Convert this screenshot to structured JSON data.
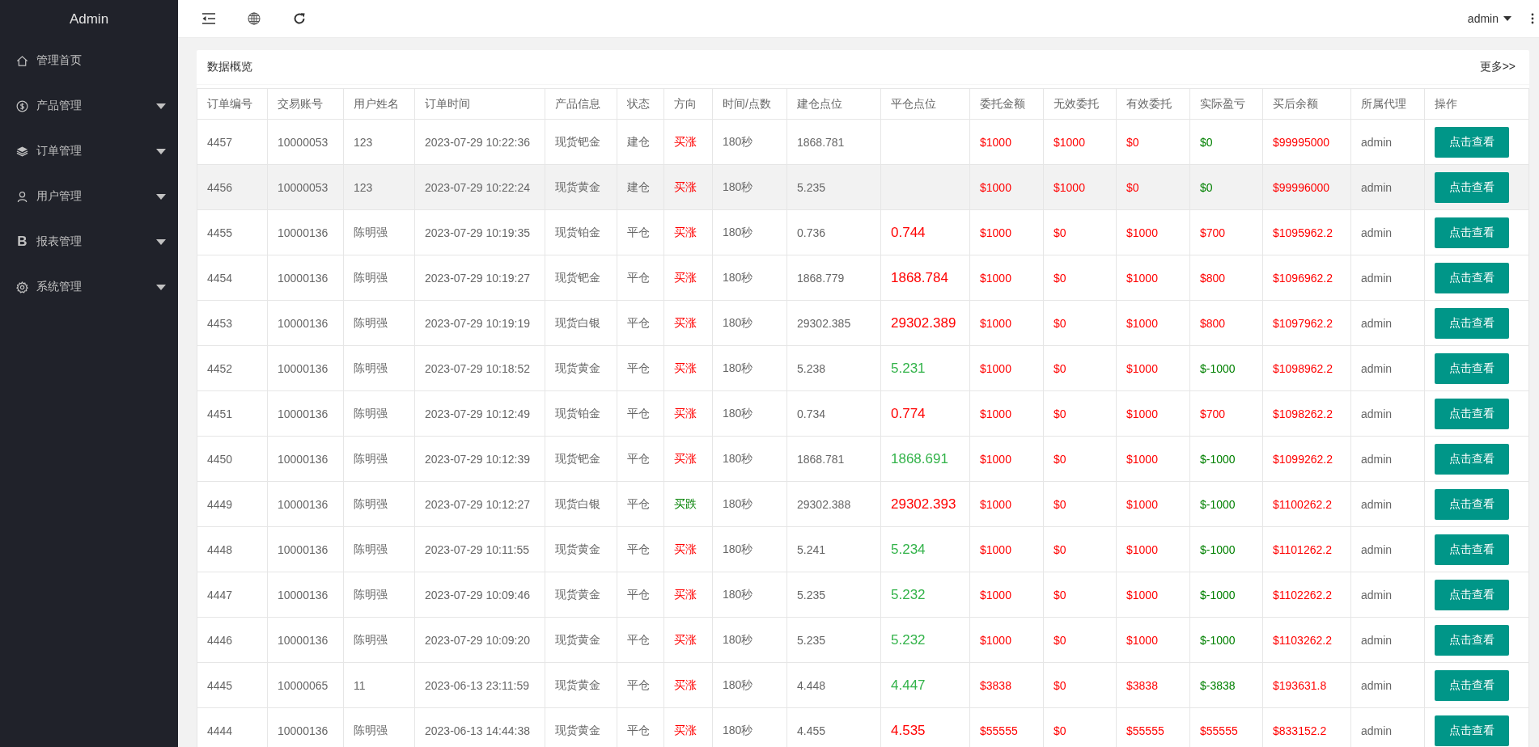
{
  "sidebar": {
    "brand": "Admin",
    "items": [
      {
        "label": "管理首页",
        "kind": "link"
      },
      {
        "label": "产品管理",
        "kind": "menu",
        "expanded": false
      },
      {
        "label": "订单管理",
        "kind": "menu",
        "expanded": false
      },
      {
        "label": "用户管理",
        "kind": "menu",
        "expanded": false
      },
      {
        "label": "报表管理",
        "kind": "menu",
        "expanded": false,
        "glyph": "B"
      },
      {
        "label": "系统管理",
        "kind": "menu",
        "expanded": false
      }
    ]
  },
  "topbar": {
    "user": "admin"
  },
  "card": {
    "title": "数据概览",
    "more": "更多>>"
  },
  "table": {
    "columns": [
      "订单编号",
      "交易账号",
      "用户姓名",
      "订单时间",
      "产品信息",
      "状态",
      "方向",
      "时间/点数",
      "建仓点位",
      "平仓点位",
      "委托金额",
      "无效委托",
      "有效委托",
      "实际盈亏",
      "买后余额",
      "所属代理",
      "操作"
    ],
    "rows": [
      {
        "order_no": "4457",
        "account": "10000053",
        "user_name": "123",
        "order_time": "2023-07-29 10:22:36",
        "product": "现货钯金",
        "status": "建仓",
        "direction": {
          "text": "买涨",
          "color": "#ff0000"
        },
        "duration": "180秒",
        "open_price": "1868.781",
        "amount": "$1000",
        "invalid": "$1000",
        "valid": "$0",
        "pnl": {
          "text": "$0",
          "color": "#008000"
        },
        "balance": "$99995000",
        "agent": "admin",
        "action": "点击查看",
        "highlighted": false
      },
      {
        "order_no": "4456",
        "account": "10000053",
        "user_name": "123",
        "order_time": "2023-07-29 10:22:24",
        "product": "现货黄金",
        "status": "建仓",
        "direction": {
          "text": "买涨",
          "color": "#ff0000"
        },
        "duration": "180秒",
        "open_price": "5.235",
        "amount": "$1000",
        "invalid": "$1000",
        "valid": "$0",
        "pnl": {
          "text": "$0",
          "color": "#008000"
        },
        "balance": "$99996000",
        "agent": "admin",
        "action": "点击查看",
        "highlighted": true
      },
      {
        "order_no": "4455",
        "account": "10000136",
        "user_name": "陈明强",
        "order_time": "2023-07-29 10:19:35",
        "product": "现货铂金",
        "status": "平仓",
        "direction": {
          "text": "买涨",
          "color": "#ff0000"
        },
        "duration": "180秒",
        "open_price": "0.736",
        "close_price": {
          "text": "0.744",
          "color": "#ff0000"
        },
        "amount": "$1000",
        "invalid": "$0",
        "valid": "$1000",
        "pnl": {
          "text": "$700",
          "color": "#ff0000"
        },
        "balance": "$1095962.2",
        "agent": "admin",
        "action": "点击查看",
        "highlighted": false
      },
      {
        "order_no": "4454",
        "account": "10000136",
        "user_name": "陈明强",
        "order_time": "2023-07-29 10:19:27",
        "product": "现货钯金",
        "status": "平仓",
        "direction": {
          "text": "买涨",
          "color": "#ff0000"
        },
        "duration": "180秒",
        "open_price": "1868.779",
        "close_price": {
          "text": "1868.784",
          "color": "#ff0000"
        },
        "amount": "$1000",
        "invalid": "$0",
        "valid": "$1000",
        "pnl": {
          "text": "$800",
          "color": "#ff0000"
        },
        "balance": "$1096962.2",
        "agent": "admin",
        "action": "点击查看",
        "highlighted": false
      },
      {
        "order_no": "4453",
        "account": "10000136",
        "user_name": "陈明强",
        "order_time": "2023-07-29 10:19:19",
        "product": "现货白银",
        "status": "平仓",
        "direction": {
          "text": "买涨",
          "color": "#ff0000"
        },
        "duration": "180秒",
        "open_price": "29302.385",
        "close_price": {
          "text": "29302.389",
          "color": "#ff0000"
        },
        "amount": "$1000",
        "invalid": "$0",
        "valid": "$1000",
        "pnl": {
          "text": "$800",
          "color": "#ff0000"
        },
        "balance": "$1097962.2",
        "agent": "admin",
        "action": "点击查看",
        "highlighted": false
      },
      {
        "order_no": "4452",
        "account": "10000136",
        "user_name": "陈明强",
        "order_time": "2023-07-29 10:18:52",
        "product": "现货黄金",
        "status": "平仓",
        "direction": {
          "text": "买涨",
          "color": "#ff0000"
        },
        "duration": "180秒",
        "open_price": "5.238",
        "close_price": {
          "text": "5.231",
          "color": "#33b34a"
        },
        "amount": "$1000",
        "invalid": "$0",
        "valid": "$1000",
        "pnl": {
          "text": "$-1000",
          "color": "#008000"
        },
        "balance": "$1098962.2",
        "agent": "admin",
        "action": "点击查看",
        "highlighted": false
      },
      {
        "order_no": "4451",
        "account": "10000136",
        "user_name": "陈明强",
        "order_time": "2023-07-29 10:12:49",
        "product": "现货铂金",
        "status": "平仓",
        "direction": {
          "text": "买涨",
          "color": "#ff0000"
        },
        "duration": "180秒",
        "open_price": "0.734",
        "close_price": {
          "text": "0.774",
          "color": "#ff0000"
        },
        "amount": "$1000",
        "invalid": "$0",
        "valid": "$1000",
        "pnl": {
          "text": "$700",
          "color": "#ff0000"
        },
        "balance": "$1098262.2",
        "agent": "admin",
        "action": "点击查看",
        "highlighted": false
      },
      {
        "order_no": "4450",
        "account": "10000136",
        "user_name": "陈明强",
        "order_time": "2023-07-29 10:12:39",
        "product": "现货钯金",
        "status": "平仓",
        "direction": {
          "text": "买涨",
          "color": "#ff0000"
        },
        "duration": "180秒",
        "open_price": "1868.781",
        "close_price": {
          "text": "1868.691",
          "color": "#33b34a"
        },
        "amount": "$1000",
        "invalid": "$0",
        "valid": "$1000",
        "pnl": {
          "text": "$-1000",
          "color": "#008000"
        },
        "balance": "$1099262.2",
        "agent": "admin",
        "action": "点击查看",
        "highlighted": false
      },
      {
        "order_no": "4449",
        "account": "10000136",
        "user_name": "陈明强",
        "order_time": "2023-07-29 10:12:27",
        "product": "现货白银",
        "status": "平仓",
        "direction": {
          "text": "买跌",
          "color": "#008000"
        },
        "duration": "180秒",
        "open_price": "29302.388",
        "close_price": {
          "text": "29302.393",
          "color": "#ff0000"
        },
        "amount": "$1000",
        "invalid": "$0",
        "valid": "$1000",
        "pnl": {
          "text": "$-1000",
          "color": "#008000"
        },
        "balance": "$1100262.2",
        "agent": "admin",
        "action": "点击查看",
        "highlighted": false
      },
      {
        "order_no": "4448",
        "account": "10000136",
        "user_name": "陈明强",
        "order_time": "2023-07-29 10:11:55",
        "product": "现货黄金",
        "status": "平仓",
        "direction": {
          "text": "买涨",
          "color": "#ff0000"
        },
        "duration": "180秒",
        "open_price": "5.241",
        "close_price": {
          "text": "5.234",
          "color": "#33b34a"
        },
        "amount": "$1000",
        "invalid": "$0",
        "valid": "$1000",
        "pnl": {
          "text": "$-1000",
          "color": "#008000"
        },
        "balance": "$1101262.2",
        "agent": "admin",
        "action": "点击查看",
        "highlighted": false
      },
      {
        "order_no": "4447",
        "account": "10000136",
        "user_name": "陈明强",
        "order_time": "2023-07-29 10:09:46",
        "product": "现货黄金",
        "status": "平仓",
        "direction": {
          "text": "买涨",
          "color": "#ff0000"
        },
        "duration": "180秒",
        "open_price": "5.235",
        "close_price": {
          "text": "5.232",
          "color": "#33b34a"
        },
        "amount": "$1000",
        "invalid": "$0",
        "valid": "$1000",
        "pnl": {
          "text": "$-1000",
          "color": "#008000"
        },
        "balance": "$1102262.2",
        "agent": "admin",
        "action": "点击查看",
        "highlighted": false
      },
      {
        "order_no": "4446",
        "account": "10000136",
        "user_name": "陈明强",
        "order_time": "2023-07-29 10:09:20",
        "product": "现货黄金",
        "status": "平仓",
        "direction": {
          "text": "买涨",
          "color": "#ff0000"
        },
        "duration": "180秒",
        "open_price": "5.235",
        "close_price": {
          "text": "5.232",
          "color": "#33b34a"
        },
        "amount": "$1000",
        "invalid": "$0",
        "valid": "$1000",
        "pnl": {
          "text": "$-1000",
          "color": "#008000"
        },
        "balance": "$1103262.2",
        "agent": "admin",
        "action": "点击查看",
        "highlighted": false
      },
      {
        "order_no": "4445",
        "account": "10000065",
        "user_name": "11",
        "order_time": "2023-06-13 23:11:59",
        "product": "现货黄金",
        "status": "平仓",
        "direction": {
          "text": "买涨",
          "color": "#ff0000"
        },
        "duration": "180秒",
        "open_price": "4.448",
        "close_price": {
          "text": "4.447",
          "color": "#33b34a"
        },
        "amount": "$3838",
        "invalid": "$0",
        "valid": "$3838",
        "pnl": {
          "text": "$-3838",
          "color": "#008000"
        },
        "balance": "$193631.8",
        "agent": "admin",
        "action": "点击查看",
        "highlighted": false
      },
      {
        "order_no": "4444",
        "account": "10000136",
        "user_name": "陈明强",
        "order_time": "2023-06-13 14:44:38",
        "product": "现货黄金",
        "status": "平仓",
        "direction": {
          "text": "买涨",
          "color": "#ff0000"
        },
        "duration": "180秒",
        "open_price": "4.455",
        "close_price": {
          "text": "4.535",
          "color": "#ff0000"
        },
        "amount": "$55555",
        "invalid": "$0",
        "valid": "$55555",
        "pnl": {
          "text": "$55555",
          "color": "#ff0000"
        },
        "balance": "$833152.2",
        "agent": "admin",
        "action": "点击查看",
        "highlighted": false
      }
    ]
  }
}
